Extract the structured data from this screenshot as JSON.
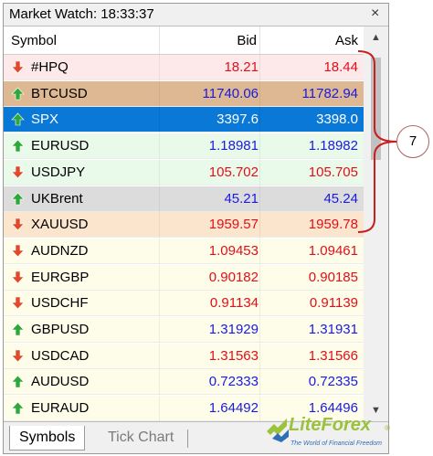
{
  "window": {
    "title": "Market Watch: 18:33:37",
    "close_glyph": "×"
  },
  "columns": {
    "symbol": "Symbol",
    "bid": "Bid",
    "ask": "Ask"
  },
  "rows": [
    {
      "symbol": "#HPQ",
      "bid": "18.21",
      "ask": "18.44",
      "direction": "down",
      "bg": "#fde9ea",
      "price_color": "#e0101a"
    },
    {
      "symbol": "BTCUSD",
      "bid": "11740.06",
      "ask": "11782.94",
      "direction": "up",
      "bg": "#ddb892",
      "price_color": "#1a1ae0"
    },
    {
      "symbol": "SPX",
      "bid": "3397.6",
      "ask": "3398.0",
      "direction": "up",
      "bg": "#0a78d6",
      "price_color": "#ffffff",
      "selected": true
    },
    {
      "symbol": "EURUSD",
      "bid": "1.18981",
      "ask": "1.18982",
      "direction": "up",
      "bg": "#eafaea",
      "price_color": "#1a1ae0"
    },
    {
      "symbol": "USDJPY",
      "bid": "105.702",
      "ask": "105.705",
      "direction": "down",
      "bg": "#eafaea",
      "price_color": "#e0101a"
    },
    {
      "symbol": "UKBrent",
      "bid": "45.21",
      "ask": "45.24",
      "direction": "up",
      "bg": "#dcdcdc",
      "price_color": "#1a1ae0"
    },
    {
      "symbol": "XAUUSD",
      "bid": "1959.57",
      "ask": "1959.78",
      "direction": "down",
      "bg": "#fbe5cc",
      "price_color": "#e0101a"
    },
    {
      "symbol": "AUDNZD",
      "bid": "1.09453",
      "ask": "1.09461",
      "direction": "down",
      "bg": "#fdfde9",
      "price_color": "#e0101a"
    },
    {
      "symbol": "EURGBP",
      "bid": "0.90182",
      "ask": "0.90185",
      "direction": "down",
      "bg": "#fdfde9",
      "price_color": "#e0101a"
    },
    {
      "symbol": "USDCHF",
      "bid": "0.91134",
      "ask": "0.91139",
      "direction": "down",
      "bg": "#fdfde9",
      "price_color": "#e0101a"
    },
    {
      "symbol": "GBPUSD",
      "bid": "1.31929",
      "ask": "1.31931",
      "direction": "up",
      "bg": "#fdfde9",
      "price_color": "#1a1ae0"
    },
    {
      "symbol": "USDCAD",
      "bid": "1.31563",
      "ask": "1.31566",
      "direction": "down",
      "bg": "#fdfde9",
      "price_color": "#e0101a"
    },
    {
      "symbol": "AUDUSD",
      "bid": "0.72333",
      "ask": "0.72335",
      "direction": "up",
      "bg": "#fdfde9",
      "price_color": "#1a1ae0"
    },
    {
      "symbol": "EURAUD",
      "bid": "1.64492",
      "ask": "1.64496",
      "direction": "up",
      "bg": "#fdfde9",
      "price_color": "#1a1ae0"
    },
    {
      "symbol": "",
      "bid": "",
      "ask": "",
      "direction": "up",
      "bg": "#fdfde9",
      "price_color": "#1a1ae0"
    }
  ],
  "tabs": [
    {
      "label": "Symbols",
      "active": true
    },
    {
      "label": "Tick Chart",
      "active": false
    }
  ],
  "annotation": {
    "callout_number": "7"
  },
  "logo": {
    "name": "LiteForex",
    "tagline": "The World of Financial Freedom",
    "registered": "®"
  },
  "colors": {
    "up_arrow": "#2fa83a",
    "down_arrow": "#e04a2a",
    "bracket": "#c81e1e"
  },
  "icons": {
    "up": "arrow-up-icon",
    "down": "arrow-down-icon",
    "close": "close-icon",
    "scroll_up": "scroll-up-icon",
    "scroll_down": "scroll-down-icon"
  }
}
